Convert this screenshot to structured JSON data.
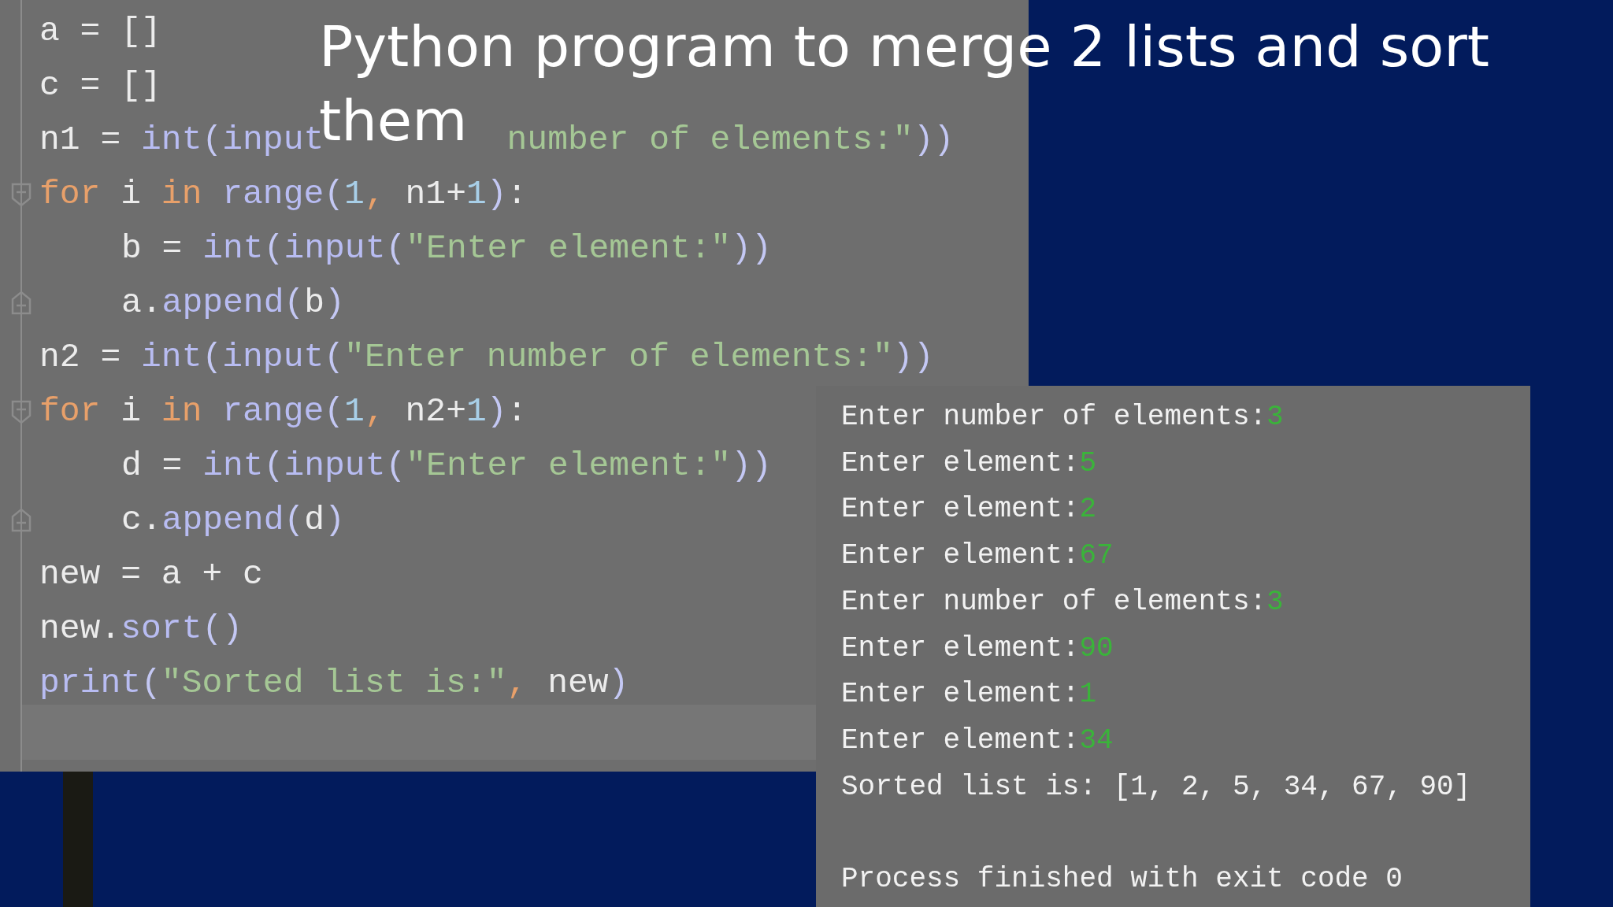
{
  "slide": {
    "title_lines": [
      "Python program to merge 2 lists and sort",
      "them"
    ]
  },
  "editor": {
    "lines": [
      {
        "tokens": [
          {
            "text": "a = []",
            "kind": "plain"
          }
        ]
      },
      {
        "tokens": [
          {
            "text": "c = []",
            "kind": "plain"
          }
        ]
      },
      {
        "tokens": [
          {
            "text": "n1 = ",
            "kind": "plain"
          },
          {
            "text": "int",
            "kind": "builtin"
          },
          {
            "text": "(",
            "kind": "paren"
          },
          {
            "text": "input",
            "kind": "builtin"
          }
        ],
        "after_cover": [
          {
            "text": "number of elements:\"",
            "kind": "string"
          },
          {
            "text": "))",
            "kind": "paren"
          }
        ]
      },
      {
        "tokens": [
          {
            "text": "for",
            "kind": "keyword"
          },
          {
            "text": " i ",
            "kind": "plain"
          },
          {
            "text": "in ",
            "kind": "keyword"
          },
          {
            "text": "range",
            "kind": "builtin"
          },
          {
            "text": "(",
            "kind": "paren"
          },
          {
            "text": "1",
            "kind": "number"
          },
          {
            "text": ",",
            "kind": "punct"
          },
          {
            "text": " n1+",
            "kind": "plain"
          },
          {
            "text": "1",
            "kind": "number"
          },
          {
            "text": ")",
            "kind": "paren"
          },
          {
            "text": ":",
            "kind": "plain"
          }
        ],
        "children": [
          {
            "tokens": [
              {
                "text": "b = ",
                "kind": "plain"
              },
              {
                "text": "int",
                "kind": "builtin"
              },
              {
                "text": "(",
                "kind": "paren"
              },
              {
                "text": "input",
                "kind": "builtin"
              },
              {
                "text": "(",
                "kind": "paren"
              },
              {
                "text": "\"Enter element:\"",
                "kind": "string"
              },
              {
                "text": "))",
                "kind": "paren"
              }
            ]
          },
          {
            "tokens": [
              {
                "text": "a.",
                "kind": "plain"
              },
              {
                "text": "append",
                "kind": "builtin"
              },
              {
                "text": "(",
                "kind": "paren"
              },
              {
                "text": "b",
                "kind": "plain"
              },
              {
                "text": ")",
                "kind": "paren"
              }
            ]
          }
        ]
      },
      {
        "tokens": [
          {
            "text": "n2 = ",
            "kind": "plain"
          },
          {
            "text": "int",
            "kind": "builtin"
          },
          {
            "text": "(",
            "kind": "paren"
          },
          {
            "text": "input",
            "kind": "builtin"
          },
          {
            "text": "(",
            "kind": "paren"
          },
          {
            "text": "\"Enter number of elements:\"",
            "kind": "string"
          },
          {
            "text": "))",
            "kind": "paren"
          }
        ]
      },
      {
        "tokens": [
          {
            "text": "for",
            "kind": "keyword"
          },
          {
            "text": " i ",
            "kind": "plain"
          },
          {
            "text": "in ",
            "kind": "keyword"
          },
          {
            "text": "range",
            "kind": "builtin"
          },
          {
            "text": "(",
            "kind": "paren"
          },
          {
            "text": "1",
            "kind": "number"
          },
          {
            "text": ",",
            "kind": "punct"
          },
          {
            "text": " n2+",
            "kind": "plain"
          },
          {
            "text": "1",
            "kind": "number"
          },
          {
            "text": ")",
            "kind": "paren"
          },
          {
            "text": ":",
            "kind": "plain"
          }
        ],
        "children": [
          {
            "tokens": [
              {
                "text": "d = ",
                "kind": "plain"
              },
              {
                "text": "int",
                "kind": "builtin"
              },
              {
                "text": "(",
                "kind": "paren"
              },
              {
                "text": "input",
                "kind": "builtin"
              },
              {
                "text": "(",
                "kind": "paren"
              },
              {
                "text": "\"Enter element:\"",
                "kind": "string"
              },
              {
                "text": "))",
                "kind": "paren"
              }
            ]
          },
          {
            "tokens": [
              {
                "text": "c.",
                "kind": "plain"
              },
              {
                "text": "append",
                "kind": "builtin"
              },
              {
                "text": "(",
                "kind": "paren"
              },
              {
                "text": "d",
                "kind": "plain"
              },
              {
                "text": ")",
                "kind": "paren"
              }
            ]
          }
        ]
      },
      {
        "tokens": [
          {
            "text": "new = a + c",
            "kind": "plain"
          }
        ]
      },
      {
        "tokens": [
          {
            "text": "new.",
            "kind": "plain"
          },
          {
            "text": "sort",
            "kind": "builtin"
          },
          {
            "text": "()",
            "kind": "paren"
          }
        ]
      },
      {
        "tokens": [
          {
            "text": "print",
            "kind": "builtin"
          },
          {
            "text": "(",
            "kind": "paren"
          },
          {
            "text": "\"Sorted list is:\"",
            "kind": "string"
          },
          {
            "text": ",",
            "kind": "punct"
          },
          {
            "text": " new",
            "kind": "plain"
          },
          {
            "text": ")",
            "kind": "paren"
          }
        ]
      }
    ]
  },
  "console": {
    "lines": [
      {
        "prompt": "Enter number of elements:",
        "input": "3"
      },
      {
        "prompt": "Enter element:",
        "input": "5"
      },
      {
        "prompt": "Enter element:",
        "input": "2"
      },
      {
        "prompt": "Enter element:",
        "input": "67"
      },
      {
        "prompt": "Enter number of elements:",
        "input": "3"
      },
      {
        "prompt": "Enter element:",
        "input": "90"
      },
      {
        "prompt": "Enter element:",
        "input": "1"
      },
      {
        "prompt": "Enter element:",
        "input": "34"
      },
      {
        "prompt": "Sorted list is: [1, 2, 5, 34, 67, 90]"
      }
    ],
    "status": "Process finished with exit code 0"
  }
}
